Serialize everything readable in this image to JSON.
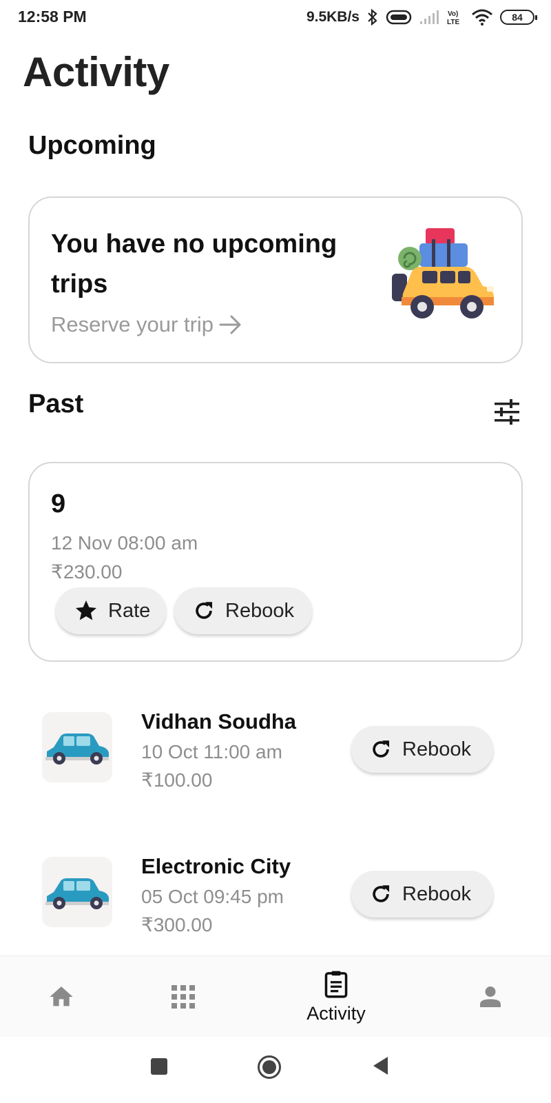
{
  "status_bar": {
    "time": "12:58 PM",
    "network_speed": "9.5KB/s",
    "battery": "84",
    "icons": [
      "bluetooth-icon",
      "vibrate-icon",
      "signal-icon",
      "volte-icon",
      "wifi-icon",
      "battery-icon"
    ]
  },
  "page": {
    "title": "Activity"
  },
  "upcoming": {
    "heading": "Upcoming",
    "empty_title": "You have no upcoming trips",
    "cta": "Reserve your trip",
    "cta_icon": "arrow-right-icon",
    "illustration": "car-luggage-illustration"
  },
  "past": {
    "heading": "Past",
    "filter_icon": "tune-icon",
    "latest": {
      "title": "9",
      "datetime": "12 Nov 08:00 am",
      "price": "₹230.00",
      "rate_label": "Rate",
      "rebook_label": "Rebook"
    },
    "trips": [
      {
        "destination": "Vidhan Soudha",
        "datetime": "10 Oct 11:00 am",
        "price": "₹100.00",
        "rebook_label": "Rebook"
      },
      {
        "destination": "Electronic City",
        "datetime": "05 Oct 09:45 pm",
        "price": "₹300.00",
        "rebook_label": "Rebook"
      }
    ]
  },
  "bottom_nav": {
    "items": [
      {
        "icon": "home-icon",
        "label": ""
      },
      {
        "icon": "grid-icon",
        "label": ""
      },
      {
        "icon": "clipboard-icon",
        "label": "Activity",
        "active": true
      },
      {
        "icon": "person-icon",
        "label": ""
      }
    ]
  },
  "colors": {
    "accent": "#111111",
    "muted_text": "#8e8e8e",
    "pill_bg": "#efefef",
    "card_border": "#d6d6d6",
    "car_yellow": "#ffbf4d",
    "car_blue": "#2a9bc0"
  }
}
